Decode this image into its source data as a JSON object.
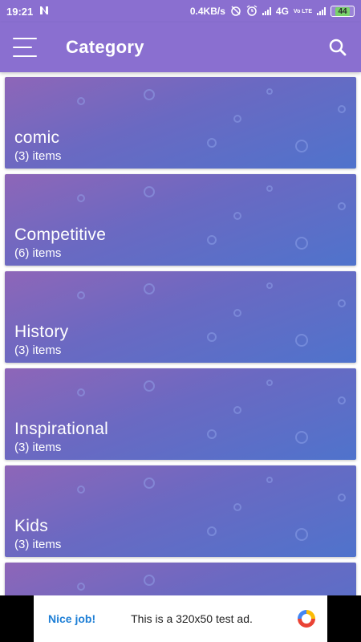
{
  "status_bar": {
    "time": "19:21",
    "notification_icon": "n-notification-icon",
    "speed": "0.4KB/s",
    "network": "4G",
    "volte": "Vo LTE",
    "battery": "44"
  },
  "app_bar": {
    "title": "Category",
    "menu_icon": "hamburger-menu-icon",
    "search_icon": "search-icon"
  },
  "categories": [
    {
      "name": "comic",
      "count": "(3) items"
    },
    {
      "name": "Competitive",
      "count": "(6) items"
    },
    {
      "name": "History",
      "count": "(3) items"
    },
    {
      "name": "Inspirational",
      "count": "(3) items"
    },
    {
      "name": "Kids",
      "count": "(3) items"
    },
    {
      "name": "",
      "count": ""
    }
  ],
  "ad": {
    "nice_label": "Nice job!",
    "text": "This is a 320x50 test ad."
  },
  "colors": {
    "app_bar": "#8a6fd0",
    "card_gradient_start": "#8e66b8",
    "card_gradient_end": "#4f73cc",
    "ad_accent": "#1e7fd6"
  }
}
